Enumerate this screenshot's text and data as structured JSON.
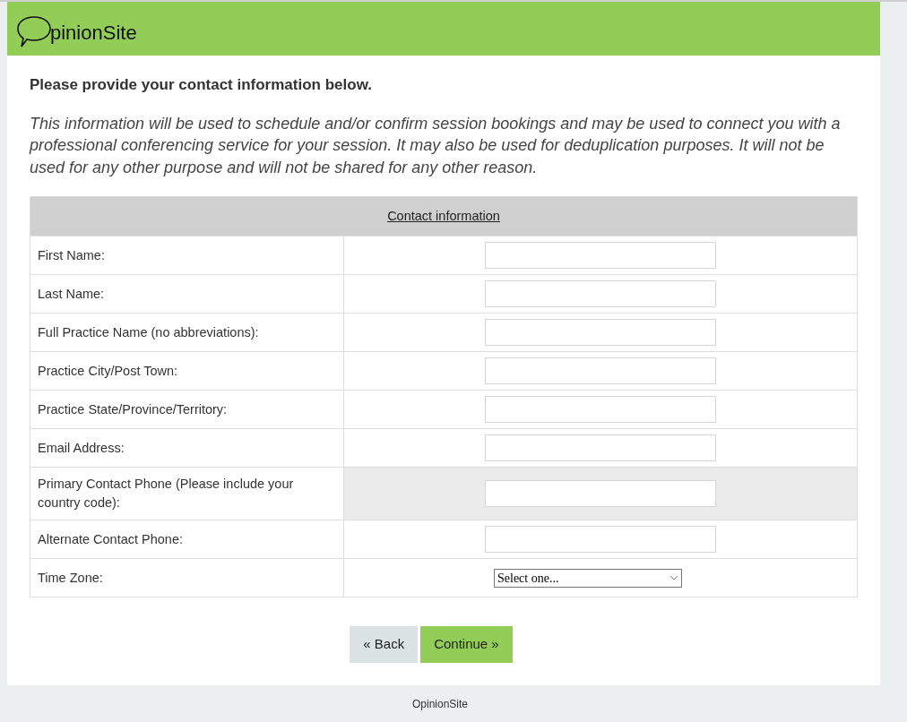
{
  "header": {
    "logo": "pinionSite"
  },
  "heading": "Please provide your contact information below.",
  "intro": "This information will be used to schedule and/or confirm session bookings and may be used to connect you with a professional conferencing service for your session. It may also be used for deduplication purposes. It will not be used for any other purpose and will not be shared for any other reason.",
  "table": {
    "title": "Contact information",
    "rows": [
      {
        "label": "First Name:",
        "kind": "input",
        "highlighted": false
      },
      {
        "label": "Last Name:",
        "kind": "input",
        "highlighted": false
      },
      {
        "label": "Full Practice Name (no abbreviations):",
        "kind": "input",
        "highlighted": false
      },
      {
        "label": "Practice City/Post Town:",
        "kind": "input",
        "highlighted": false
      },
      {
        "label": "Practice State/Province/Territory:",
        "kind": "input",
        "highlighted": false
      },
      {
        "label": "Email Address:",
        "kind": "input",
        "highlighted": false
      },
      {
        "label": "Primary Contact Phone (Please include your country code):",
        "kind": "input",
        "highlighted": true
      },
      {
        "label": "Alternate Contact Phone:",
        "kind": "input",
        "highlighted": false
      },
      {
        "label": "Time Zone:",
        "kind": "select",
        "value": "Select one...",
        "highlighted": false
      }
    ]
  },
  "buttons": [
    {
      "label": "« Back",
      "kind": "back"
    },
    {
      "label": "Continue »",
      "kind": "next"
    }
  ],
  "footer": "OpinionSite"
}
